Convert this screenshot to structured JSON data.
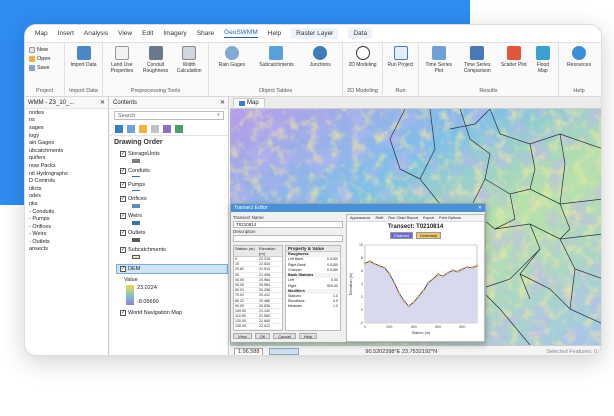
{
  "menu": {
    "items": [
      "Map",
      "Insert",
      "Analysis",
      "View",
      "Edit",
      "Imagery",
      "Share",
      "GeoSWMM",
      "Help"
    ],
    "context": [
      "Raster Layer",
      "Data"
    ]
  },
  "ribbon": {
    "project": {
      "new": "New",
      "open": "Open",
      "save": "Save",
      "label": "Project"
    },
    "import": {
      "btn": "Import Data",
      "label": "Import Data"
    },
    "preprocessing": {
      "items": [
        "Land Use Properties",
        "Conduit Roughness",
        "Width Calculation"
      ],
      "label": "Preprocessing Tools"
    },
    "object_tables": {
      "items": [
        "Rain Gages",
        "Subcatchments",
        "Junctions"
      ],
      "label": "Object Tables"
    },
    "modeling": {
      "btn": "2D Modeling",
      "label": "2D Modeling"
    },
    "run": {
      "btn": "Run Project",
      "label": "Run"
    },
    "results": {
      "items": [
        "Time Series Plot",
        "Time Series Comparison",
        "Scatter Plot",
        "Flood Map"
      ],
      "label": "Results"
    },
    "help": {
      "btn": "Resources",
      "label": "Help"
    }
  },
  "catalog": {
    "title": "WMM - Z3_10_...",
    "items": [
      "nodes",
      "ns",
      "sages",
      "logy",
      "ain Gages",
      "ubcatchments",
      "quifers",
      "now Packs",
      "nit Hydrographs",
      "D Controls",
      "ulicts",
      "odes",
      "nks",
      "- Conduits",
      "- Pumps",
      "- Orifices",
      "- Weirs",
      "- Outlets",
      "ansects"
    ]
  },
  "contents": {
    "title": "Contents",
    "search_placeholder": "Search",
    "drawing_order": "Drawing Order",
    "layers": [
      "StorageUnits",
      "Conduits",
      "Pumps",
      "Orifices",
      "Weirs",
      "Outlets",
      "Subcatchments",
      "DEM"
    ],
    "value_label": "Value",
    "value_high": "23.0224",
    "value_low": "-8.05690",
    "basemap": "World Navigation Map"
  },
  "map": {
    "tab": "Map",
    "scale": "1:96,588",
    "coords": "90.5202398°E 23.7532192°N",
    "selected": "Selected Features: 0"
  },
  "dialog": {
    "title": "Transect Editor",
    "transect_name_label": "Transect Name",
    "transect_name": "T0210814",
    "description_label": "Description",
    "table_headers": [
      "Station (m)",
      "Elevation (m)"
    ],
    "table_rows": [
      [
        "0",
        "22.216"
      ],
      [
        "10",
        "22.034"
      ],
      [
        "20.62",
        "21.910"
      ],
      [
        "30",
        "21.498"
      ],
      [
        "40.00",
        "20.984"
      ],
      [
        "50.00",
        "20.564"
      ],
      [
        "60.01",
        "20.258"
      ],
      [
        "70.01",
        "20.412"
      ],
      [
        "80.22",
        "20.486"
      ],
      [
        "90.00",
        "20.838"
      ],
      [
        "100.00",
        "21.132"
      ],
      [
        "110.00",
        "21.560"
      ],
      [
        "120.00",
        "21.840"
      ],
      [
        "130.00",
        "22.012"
      ]
    ],
    "props_title": "Property & Value",
    "props": [
      {
        "group": "Roughness"
      },
      {
        "k": "Left Bank",
        "v": "0.0150"
      },
      {
        "k": "Right Bank",
        "v": "0.0150"
      },
      {
        "k": "Channel",
        "v": "0.0150"
      },
      {
        "group": "Bank Stations"
      },
      {
        "k": "Left",
        "v": "0.00"
      },
      {
        "k": "Right",
        "v": "920.00"
      },
      {
        "group": "Modifiers"
      },
      {
        "k": "Stations",
        "v": "1.0"
      },
      {
        "k": "Elevations",
        "v": "0.0"
      },
      {
        "k": "Meander",
        "v": "1.0"
      }
    ],
    "buttons": [
      "View",
      "OK",
      "Cancel",
      "Help"
    ],
    "chart_tools": [
      "Appearance",
      "Refit",
      "Run Chart Report",
      "Export",
      "Print Options"
    ],
    "legend": [
      "Channel",
      "Overbank"
    ]
  },
  "chart_data": {
    "type": "area",
    "title": "Transect: T0210814",
    "xlabel": "Station (m)",
    "ylabel": "Elevation (m)",
    "xlim": [
      0,
      920
    ],
    "ylim": [
      -2,
      10
    ],
    "series": [
      {
        "name": "Channel",
        "x": [
          0,
          40,
          80,
          120,
          160,
          200,
          240,
          280,
          320,
          360,
          400,
          440,
          480,
          520,
          560,
          600,
          640,
          680,
          720,
          760,
          800,
          840,
          880,
          920
        ],
        "values": [
          7.2,
          7.5,
          7.1,
          6.8,
          6.5,
          5.6,
          4.2,
          2.6,
          1.4,
          0.6,
          1.2,
          2.1,
          3.0,
          4.2,
          4.8,
          5.5,
          5.2,
          5.7,
          6.1,
          5.9,
          6.3,
          6.6,
          6.5,
          6.8
        ]
      }
    ],
    "colors": {
      "fill": "#d8d8ef",
      "line": "#333366",
      "channel": "#6b6bd6",
      "overbank": "#f0c869"
    }
  }
}
